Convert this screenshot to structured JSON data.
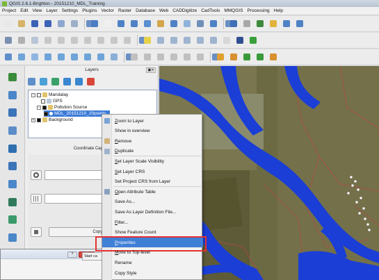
{
  "window": {
    "title": "QGIS 2.6.1-Brighton - 20151210_MDL_Training"
  },
  "menu": {
    "items": [
      "Project",
      "Edit",
      "View",
      "Layer",
      "Settings",
      "Plugins",
      "Vector",
      "Raster",
      "Database",
      "Web",
      "CADDigitize",
      "CadTools",
      "MMQGIS",
      "Processing",
      "Help"
    ]
  },
  "layers_panel": {
    "title": "Layers",
    "tree": [
      {
        "label": "Mandalay",
        "checked": false,
        "group": true,
        "expanded": true
      },
      {
        "label": "GPS",
        "checked": false,
        "group": false
      },
      {
        "label": "Pollution Source",
        "checked": true,
        "group": true,
        "expanded": true
      },
      {
        "label": "MDL_20151210_20points",
        "checked": true,
        "group": false,
        "selected": true
      },
      {
        "label": "Background",
        "checked": true,
        "group": true,
        "expanded": false
      }
    ]
  },
  "coordinate_capture": {
    "title": "Coordinate Capture",
    "copy_label": "Copy to clip",
    "start_label": "Start ca"
  },
  "context_menu": {
    "items": [
      {
        "label": "Zoom to Layer",
        "u": "Z",
        "rest": "oom to Layer",
        "icon": "zoom-icon",
        "color": "#7ba4d4"
      },
      {
        "label": "Show in overview",
        "u": "",
        "rest": "Show in overview",
        "icon": "",
        "color": ""
      },
      {
        "label": "Remove",
        "u": "R",
        "rest": "emove",
        "icon": "remove-icon",
        "color": "#d2b47a"
      },
      {
        "label": "Duplicate",
        "u": "D",
        "rest": "uplicate",
        "icon": "duplicate-icon",
        "color": "#9fb3cc"
      },
      {
        "label": "Set Layer Scale Visibility",
        "u": "S",
        "rest": "et Layer Scale Visibility",
        "icon": "",
        "color": ""
      },
      {
        "label": "Set Layer CRS",
        "u": "S",
        "rest": "et Layer CRS",
        "icon": "",
        "color": ""
      },
      {
        "label": "Set Project CRS from Layer",
        "u": "",
        "rest": "Set Project CRS from Layer",
        "icon": "",
        "color": ""
      },
      {
        "label": "Open Attribute Table",
        "u": "O",
        "rest": "pen Attribute Table",
        "icon": "table-icon",
        "color": "#8aa2c0"
      },
      {
        "label": "Save As...",
        "u": "",
        "rest": "Save As...",
        "icon": "",
        "color": ""
      },
      {
        "label": "Save As Layer Definition File...",
        "u": "",
        "rest": "Save As Layer Definition File...",
        "icon": "",
        "color": ""
      },
      {
        "label": "Filter...",
        "u": "F",
        "rest": "ilter...",
        "icon": "",
        "color": ""
      },
      {
        "label": "Show Feature Count",
        "u": "",
        "rest": "Show Feature Count",
        "icon": "",
        "color": ""
      },
      {
        "label": "Properties",
        "u": "P",
        "rest": "roperties",
        "icon": "",
        "color": ""
      },
      {
        "label": "Move to Top-level",
        "u": "M",
        "rest": "ove to Top-level",
        "icon": "",
        "color": ""
      },
      {
        "label": "Rename",
        "u": "",
        "rest": "Rename",
        "icon": "",
        "color": ""
      },
      {
        "label": "Copy Style",
        "u": "",
        "rest": "Copy Style",
        "icon": "",
        "color": ""
      }
    ],
    "highlighted": "Properties"
  },
  "dialog": {
    "help_label": "?",
    "close_label": "X"
  },
  "colors": {
    "selection": "#3f7fd6",
    "highlight_box": "#e53030",
    "river": "#1a3ed6",
    "map_boundary": "#b04a4a"
  }
}
